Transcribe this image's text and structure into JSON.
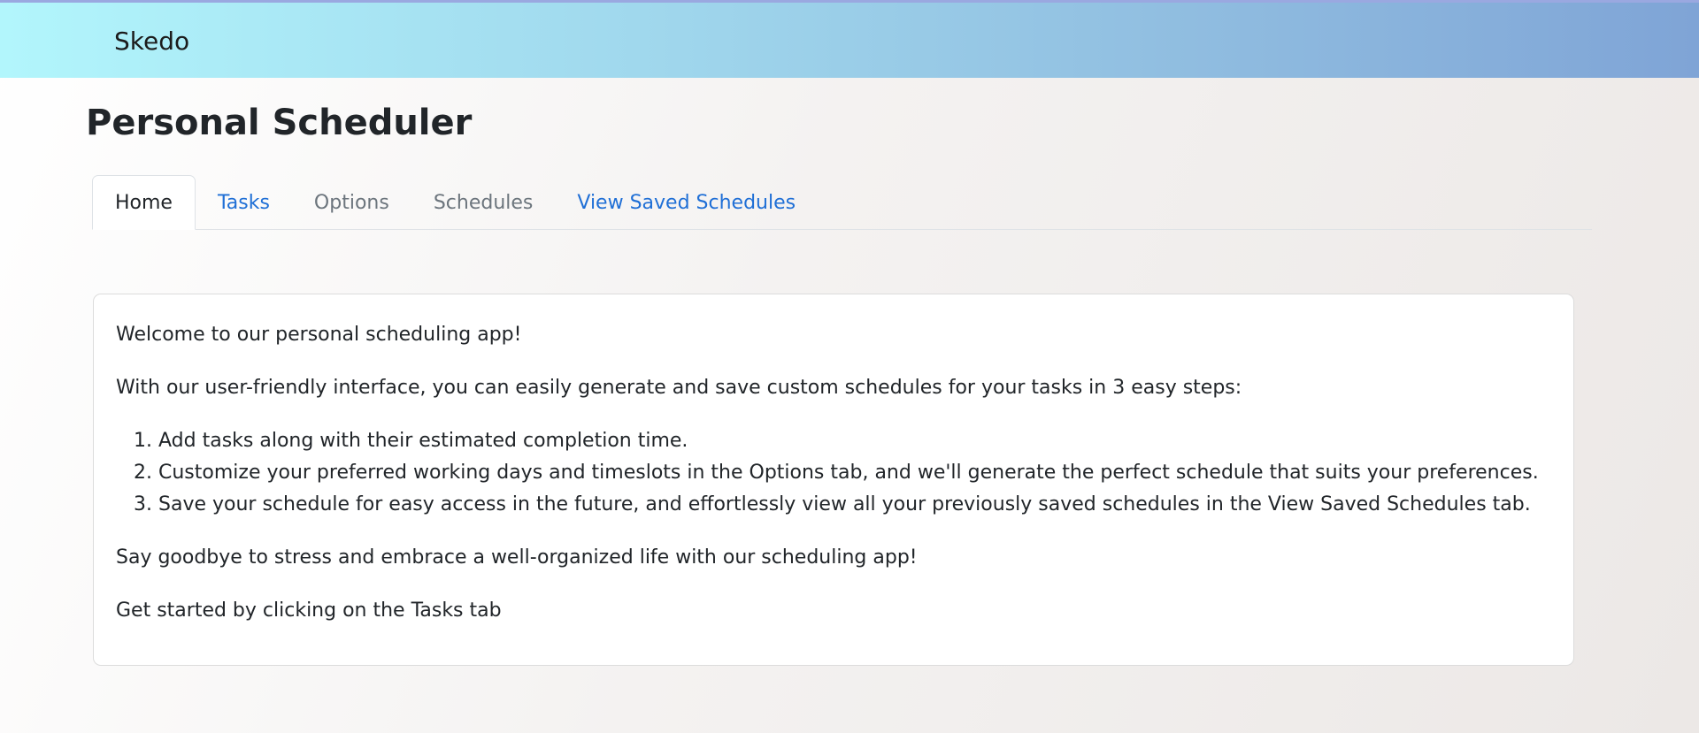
{
  "navbar": {
    "brand": "Skedo"
  },
  "page": {
    "title": "Personal Scheduler"
  },
  "tabs": [
    {
      "label": "Home",
      "state": "active"
    },
    {
      "label": "Tasks",
      "state": "link"
    },
    {
      "label": "Options",
      "state": "disabled"
    },
    {
      "label": "Schedules",
      "state": "disabled"
    },
    {
      "label": "View Saved Schedules",
      "state": "link"
    }
  ],
  "home": {
    "welcome": "Welcome to our personal scheduling app!",
    "intro": "With our user-friendly interface, you can easily generate and save custom schedules for your tasks in 3 easy steps:",
    "steps": [
      "Add tasks along with their estimated completion time.",
      "Customize your preferred working days and timeslots in the Options tab, and we'll generate the perfect schedule that suits your preferences.",
      "Save your schedule for easy access in the future, and effortlessly view all your previously saved schedules in the View Saved Schedules tab."
    ],
    "outro": "Say goodbye to stress and embrace a well-organized life with our scheduling app!",
    "cta": "Get started by clicking on the Tasks tab"
  },
  "colors": {
    "link": "#1f6fd6",
    "muted": "#6c757d",
    "navbar_start": "#b2f6fc",
    "navbar_end": "#7fa4d6"
  }
}
